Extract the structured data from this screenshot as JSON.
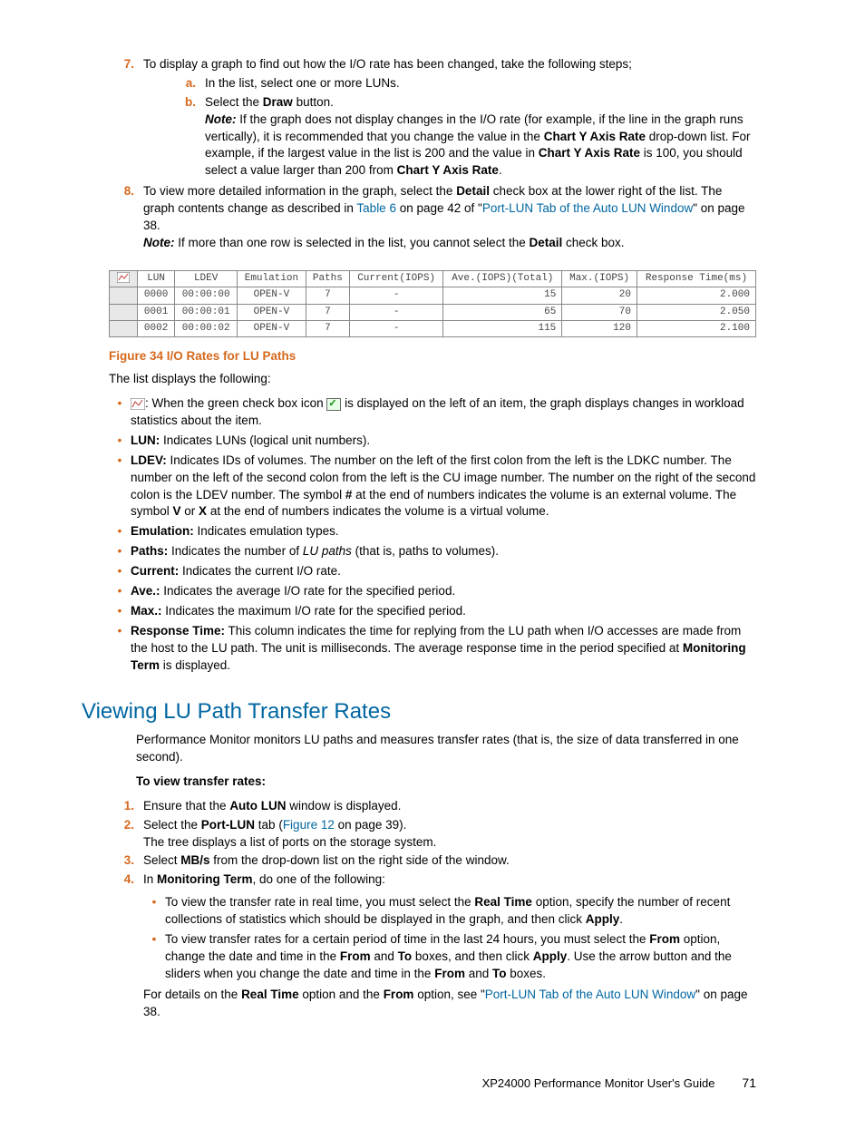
{
  "steps_top": {
    "s7": {
      "num": "7.",
      "body": "To display a graph to find out how the I/O rate has been changed, take the following steps;",
      "a_num": "a.",
      "a_body": "In the list, select one or more LUNs.",
      "b_num": "b.",
      "b_body_pre": "Select the ",
      "b_bold": "Draw",
      "b_body_post": " button.",
      "b_note_label": "Note:",
      "b_note_1": " If the graph does not display changes in the I/O rate (for example, if the line in the graph runs vertically), it is recommended that you change the value in the ",
      "b_note_bold1": "Chart Y Axis Rate",
      "b_note_2": " drop-down list. For example, if the largest value in the list is 200 and the value in ",
      "b_note_bold2": "Chart Y Axis Rate",
      "b_note_3": " is 100, you should select a value larger than 200 from ",
      "b_note_bold3": "Chart Y Axis Rate",
      "b_note_4": "."
    },
    "s8": {
      "num": "8.",
      "p1_a": "To view more detailed information in the graph, select the ",
      "p1_b": "Detail",
      "p1_c": " check box at the lower right of the list. The graph contents change as described in ",
      "p1_link1": "Table 6",
      "p1_d": " on page 42 of \"",
      "p1_link2": "Port-LUN Tab of the Auto LUN Window",
      "p1_e": "\" on page 38.",
      "note_label": "Note:",
      "note_a": " If more than one row is selected in the list, you cannot select the ",
      "note_b": "Detail",
      "note_c": " check box."
    }
  },
  "table": {
    "headers": [
      "",
      "LUN",
      "LDEV",
      "Emulation",
      "Paths",
      "Current(IOPS)",
      "Ave.(IOPS)(Total)",
      "Max.(IOPS)",
      "Response Time(ms)"
    ],
    "rows": [
      [
        "",
        "0000",
        "00:00:00",
        "OPEN-V",
        "7",
        "-",
        "15",
        "20",
        "2.000"
      ],
      [
        "",
        "0001",
        "00:00:01",
        "OPEN-V",
        "7",
        "-",
        "65",
        "70",
        "2.050"
      ],
      [
        "",
        "0002",
        "00:00:02",
        "OPEN-V",
        "7",
        "-",
        "115",
        "120",
        "2.100"
      ]
    ]
  },
  "fig_caption": "Figure 34 I/O Rates for LU Paths",
  "list_intro": "The list displays the following:",
  "desc_bullets": [
    {
      "pre": "",
      "icon": "chart",
      "mid": ": When the green check box icon ",
      "icon2": "check",
      "post": " is displayed on the left of an item, the graph displays changes in workload statistics about the item."
    },
    {
      "bold": "LUN:",
      "post": " Indicates LUNs (logical unit numbers)."
    },
    {
      "bold": "LDEV:",
      "post_a": " Indicates IDs of volumes. The number on the left of the first colon from the left is the LDKC number. The number on the left of the second colon from the left is the CU image number. The number on the right of the second colon is the LDEV number. The symbol ",
      "b1": "#",
      "post_b": " at the end of numbers indicates the volume is an external volume. The symbol ",
      "b2": "V",
      "post_c": " or ",
      "b3": "X",
      "post_d": " at the end of numbers indicates the volume is a virtual volume."
    },
    {
      "bold": "Emulation:",
      "post": " Indicates emulation types."
    },
    {
      "bold": "Paths:",
      "post_a": " Indicates the number of ",
      "i": "LU paths",
      "post_b": " (that is, paths to volumes)."
    },
    {
      "bold": "Current:",
      "post": " Indicates the current I/O rate."
    },
    {
      "bold": "Ave.:",
      "post": " Indicates the average I/O rate for the specified period."
    },
    {
      "bold": "Max.:",
      "post": " Indicates the maximum I/O rate for the specified period."
    },
    {
      "bold": "Response Time:",
      "post_a": " This column indicates the time for replying from the LU path when I/O accesses are made from the host to the LU path. The unit is milliseconds. The average response time in the period specified at ",
      "b1": "Monitoring Term",
      "post_b": " is displayed."
    }
  ],
  "section2": {
    "heading": "Viewing LU Path Transfer Rates",
    "intro": "Performance Monitor monitors LU paths and measures transfer rates (that is, the size of data transferred in one second).",
    "sub": "To view transfer rates:",
    "s1": {
      "num": "1.",
      "a": "Ensure that the ",
      "b": "Auto LUN",
      "c": " window is displayed."
    },
    "s2": {
      "num": "2.",
      "a": "Select the ",
      "b": "Port-LUN",
      "c": " tab (",
      "link": "Figure 12",
      "d": " on page 39).",
      "line2": "The tree displays a list of ports on the storage system."
    },
    "s3": {
      "num": "3.",
      "a": "Select ",
      "b": "MB/s",
      "c": " from the drop-down list on the right side of the window."
    },
    "s4": {
      "num": "4.",
      "a": "In ",
      "b": "Monitoring Term",
      "c": ", do one of the following:",
      "bul1_a": "To view the transfer rate in real time, you must select the ",
      "bul1_b": "Real Time",
      "bul1_c": " option, specify the number of recent collections of statistics which should be displayed in the graph, and then click ",
      "bul1_d": "Apply",
      "bul1_e": ".",
      "bul2_a": "To view transfer rates for a certain period of time in the last 24 hours, you must select the ",
      "bul2_b": "From",
      "bul2_c": " option, change the date and time in the ",
      "bul2_d": "From",
      "bul2_e": " and ",
      "bul2_f": "To",
      "bul2_g": " boxes, and then click ",
      "bul2_h": "Apply",
      "bul2_i": ". Use the arrow button and the sliders when you change the date and time in the ",
      "bul2_j": "From",
      "bul2_k": " and ",
      "bul2_l": "To",
      "bul2_m": " boxes.",
      "tail_a": "For details on the ",
      "tail_b": "Real Time",
      "tail_c": " option and the ",
      "tail_d": "From",
      "tail_e": " option, see \"",
      "tail_link": "Port-LUN Tab of the Auto LUN Window",
      "tail_f": "\" on page 38."
    }
  },
  "footer": {
    "title": "XP24000 Performance Monitor User's Guide",
    "page": "71"
  }
}
